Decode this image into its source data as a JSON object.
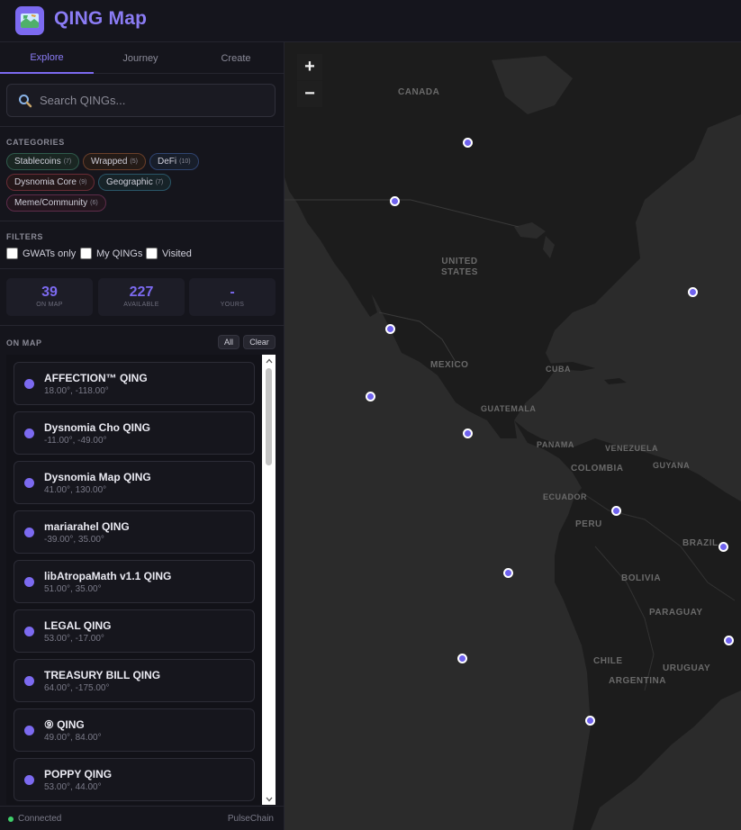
{
  "header": {
    "title": "QING Map",
    "logo_icon": "map-icon"
  },
  "tabs": [
    {
      "label": "Explore",
      "active": true
    },
    {
      "label": "Journey",
      "active": false
    },
    {
      "label": "Create",
      "active": false
    }
  ],
  "search": {
    "placeholder": "Search QINGs...",
    "value": ""
  },
  "categories": {
    "label": "CATEGORIES",
    "chips": [
      {
        "label": "Stablecoins",
        "count": "(7)",
        "color": "#2f5a4c"
      },
      {
        "label": "Wrapped",
        "count": "(5)",
        "color": "#6a3f2a"
      },
      {
        "label": "DeFi",
        "count": "(10)",
        "color": "#2f4470"
      },
      {
        "label": "Dysnomia Core",
        "count": "(9)",
        "color": "#6a2c36"
      },
      {
        "label": "Geographic",
        "count": "(7)",
        "color": "#2a5668"
      },
      {
        "label": "Meme/Community",
        "count": "(6)",
        "color": "#5e2c4a"
      }
    ]
  },
  "filters": {
    "label": "FILTERS",
    "options": [
      {
        "label": "GWATs only",
        "checked": false
      },
      {
        "label": "My QINGs",
        "checked": false
      },
      {
        "label": "Visited",
        "checked": false
      }
    ]
  },
  "stats": [
    {
      "value": "39",
      "label": "ON MAP"
    },
    {
      "value": "227",
      "label": "AVAILABLE"
    },
    {
      "value": "-",
      "label": "YOURS"
    }
  ],
  "on_map": {
    "label": "ON MAP",
    "all_label": "All",
    "clear_label": "Clear",
    "items": [
      {
        "name": "AFFECTION™ QING",
        "coords": "18.00°, -118.00°"
      },
      {
        "name": "Dysnomia Cho QING",
        "coords": "-11.00°, -49.00°"
      },
      {
        "name": "Dysnomia Map QING",
        "coords": "41.00°, 130.00°"
      },
      {
        "name": "mariarahel QING",
        "coords": "-39.00°, 35.00°"
      },
      {
        "name": "libAtropaMath v1.1 QING",
        "coords": "51.00°, 35.00°"
      },
      {
        "name": "LEGAL QING",
        "coords": "53.00°, -17.00°"
      },
      {
        "name": "TREASURY BILL QING",
        "coords": "64.00°, -175.00°"
      },
      {
        "name": "⑨ QING",
        "coords": "49.00°, 84.00°"
      },
      {
        "name": "POPPY QING",
        "coords": "53.00°, 44.00°"
      }
    ]
  },
  "footer": {
    "status": "Connected",
    "network": "PulseChain",
    "status_color": "#3fcf6a"
  },
  "map": {
    "zoom_in_label": "+",
    "zoom_out_label": "−",
    "labels": [
      "CANADA",
      "UNITED STATES",
      "MEXICO",
      "CUBA",
      "GUATEMALA",
      "PANAMA",
      "VENEZUELA",
      "GUYANA",
      "COLOMBIA",
      "ECUADOR",
      "PERU",
      "BRAZIL",
      "BOLIVIA",
      "PARAGUAY",
      "CHILE",
      "URUGUAY",
      "ARGENTINA"
    ],
    "accent_color": "#6f62ee"
  }
}
